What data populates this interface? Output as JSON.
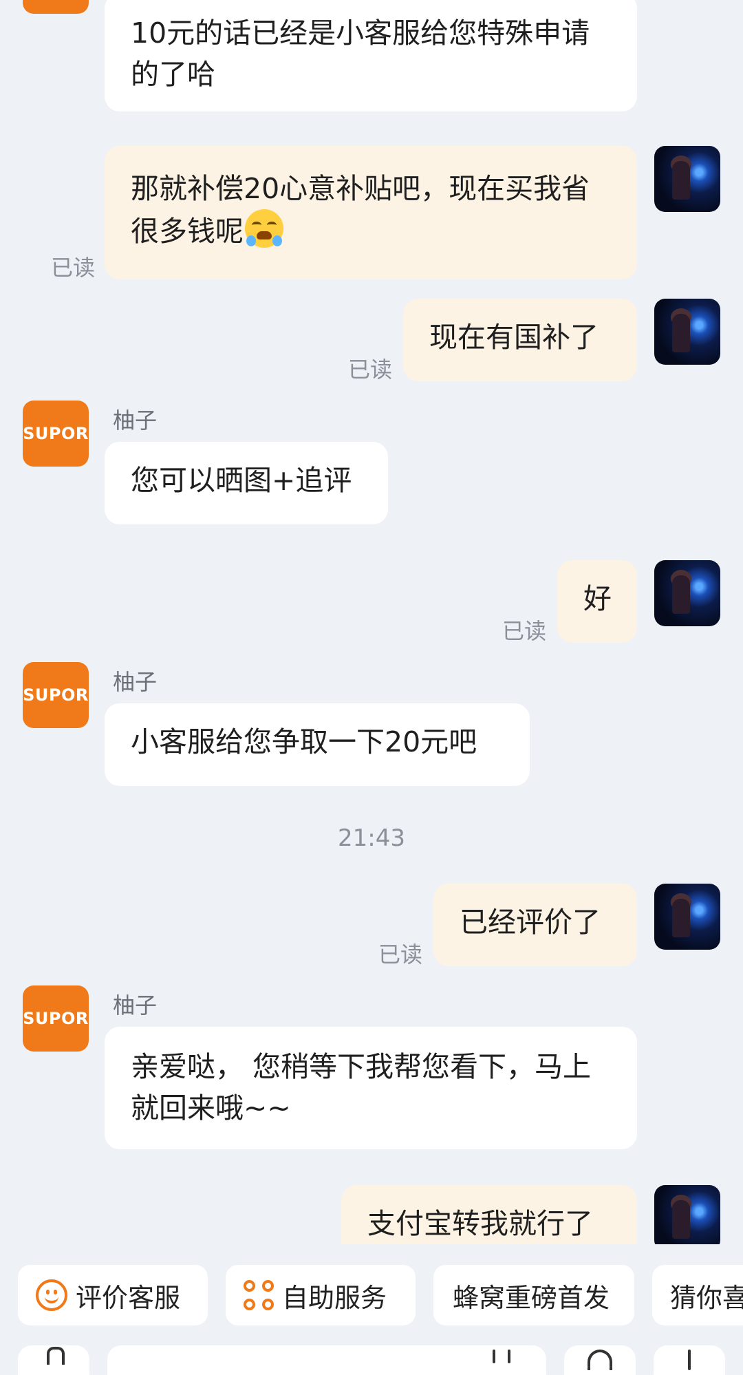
{
  "messages": [
    {
      "id": "m1",
      "side": "in",
      "text": "10元的话已经是小客服给您特殊申请的了哈"
    },
    {
      "id": "m2",
      "side": "out",
      "text": "那就补偿20心意补贴吧，现在买我省很多钱呢",
      "emoji": "loudly-crying-face",
      "read": "已读"
    },
    {
      "id": "m3",
      "side": "out",
      "text": "现在有国补了",
      "read": "已读"
    },
    {
      "id": "m4",
      "side": "in",
      "sender": "柚子",
      "text": "您可以晒图+追评"
    },
    {
      "id": "m5",
      "side": "out",
      "text": "好",
      "read": "已读"
    },
    {
      "id": "m6",
      "side": "in",
      "sender": "柚子",
      "text": "小客服给您争取一下20元吧"
    },
    {
      "id": "m7",
      "side": "out",
      "text": "已经评价了",
      "read": "已读"
    },
    {
      "id": "m8",
      "side": "in",
      "sender": "柚子",
      "text": "亲爱哒， 您稍等下我帮您看下，马上就回来哦~~"
    },
    {
      "id": "m9",
      "side": "out",
      "text": "支付宝转我就行了"
    }
  ],
  "timestamp": "21:43",
  "brand_avatar_text": "SUPOR",
  "colors": {
    "background": "#eef1f6",
    "incoming_bubble": "#ffffff",
    "outgoing_bubble": "#fdf3e4",
    "accent": "#f07a1a",
    "muted_text": "#8a8f99"
  },
  "quick_actions": [
    {
      "label": "评价客服",
      "icon": "smile-icon"
    },
    {
      "label": "自助服务",
      "icon": "apps-icon"
    },
    {
      "label": "蜂窝重磅首发",
      "icon": ""
    },
    {
      "label": "猜你喜",
      "icon": ""
    }
  ]
}
